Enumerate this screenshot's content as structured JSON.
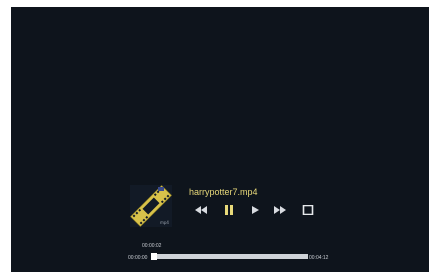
{
  "player": {
    "filename": "harrypotter7.mp4",
    "thumbnail_badge": "mp4",
    "current_time": "00:00:02",
    "start_time": "00:00:00",
    "end_time": "00:04:12",
    "progress_fraction": 0.0079,
    "accent_color": "#e8d97a",
    "background_color": "#0e141c"
  },
  "controls": [
    {
      "name": "rewind-button",
      "icon": "rewind-icon"
    },
    {
      "name": "pause-button",
      "icon": "pause-icon"
    },
    {
      "name": "play-button",
      "icon": "play-icon"
    },
    {
      "name": "fast-forward-button",
      "icon": "fast-forward-icon"
    },
    {
      "name": "stop-button",
      "icon": "stop-icon"
    }
  ]
}
